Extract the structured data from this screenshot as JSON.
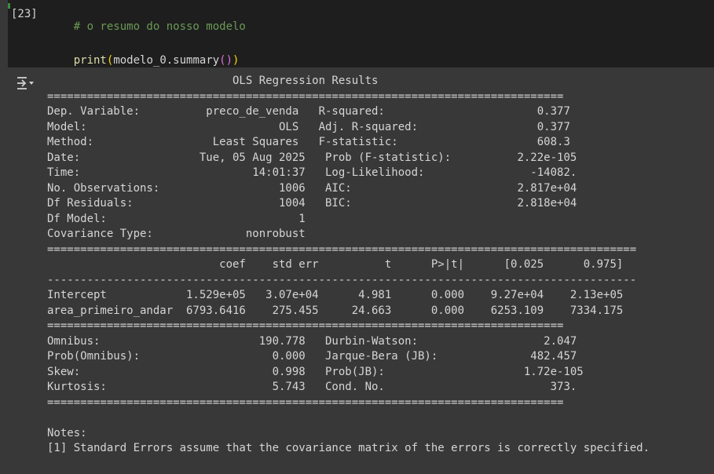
{
  "cell": {
    "execution_count": "[23]",
    "code_lines": [
      {
        "comment": "# o resumo do nosso modelo"
      },
      {
        "fn": "print",
        "open1": "(",
        "arg": "modelo_0.summary",
        "inner": "()",
        "close1": ")"
      }
    ]
  },
  "output": {
    "toggle_icon": "output-collapse-icon",
    "lines": [
      "                            OLS Regression Results",
      "==============================================================================",
      "Dep. Variable:          preco_de_venda   R-squared:                       0.377",
      "Model:                             OLS   Adj. R-squared:                  0.377",
      "Method:                  Least Squares   F-statistic:                     608.3",
      "Date:                  Tue, 05 Aug 2025   Prob (F-statistic):          2.22e-105",
      "Time:                          14:01:37   Log-Likelihood:                -14082.",
      "No. Observations:                  1006   AIC:                         2.817e+04",
      "Df Residuals:                      1004   BIC:                         2.818e+04",
      "Df Model:                             1",
      "Covariance Type:              nonrobust",
      "=========================================================================================",
      "                          coef    std err          t      P>|t|      [0.025      0.975]",
      "-----------------------------------------------------------------------------------------",
      "Intercept            1.529e+05   3.07e+04      4.981      0.000    9.27e+04    2.13e+05",
      "area_primeiro_andar  6793.6416    275.455     24.663      0.000    6253.109    7334.175",
      "==============================================================================",
      "Omnibus:                        190.778   Durbin-Watson:                   2.047",
      "Prob(Omnibus):                    0.000   Jarque-Bera (JB):              482.457",
      "Skew:                             0.998   Prob(JB):                     1.72e-105",
      "Kurtosis:                         5.743   Cond. No.                         373.",
      "==============================================================================",
      "",
      "Notes:",
      "[1] Standard Errors assume that the covariance matrix of the errors is correctly specified."
    ]
  }
}
